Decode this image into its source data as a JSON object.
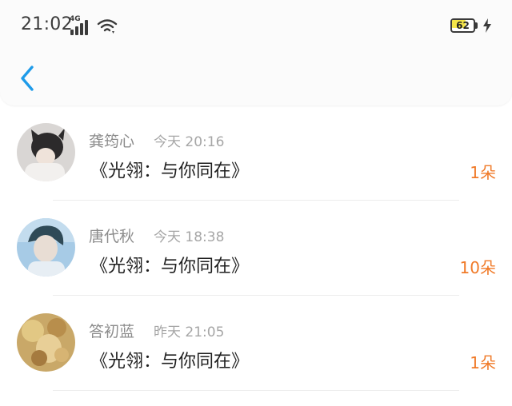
{
  "status_bar": {
    "time": "21:02",
    "network": "4G",
    "battery": "62",
    "battery_level": 0.62,
    "battery_color": "#f4e54a"
  },
  "header": {
    "back_icon": "chevron-left-icon",
    "accent_color": "#1e9be9"
  },
  "gifts": [
    {
      "name": "龚筠心",
      "time": "今天 20:16",
      "title": "《光翎：与你同在》",
      "count": "1朵"
    },
    {
      "name": "唐代秋",
      "time": "今天 18:38",
      "title": "《光翎：与你同在》",
      "count": "10朵"
    },
    {
      "name": "答初蓝",
      "time": "昨天 21:05",
      "title": "《光翎：与你同在》",
      "count": "1朵"
    }
  ],
  "count_color": "#f07a28"
}
